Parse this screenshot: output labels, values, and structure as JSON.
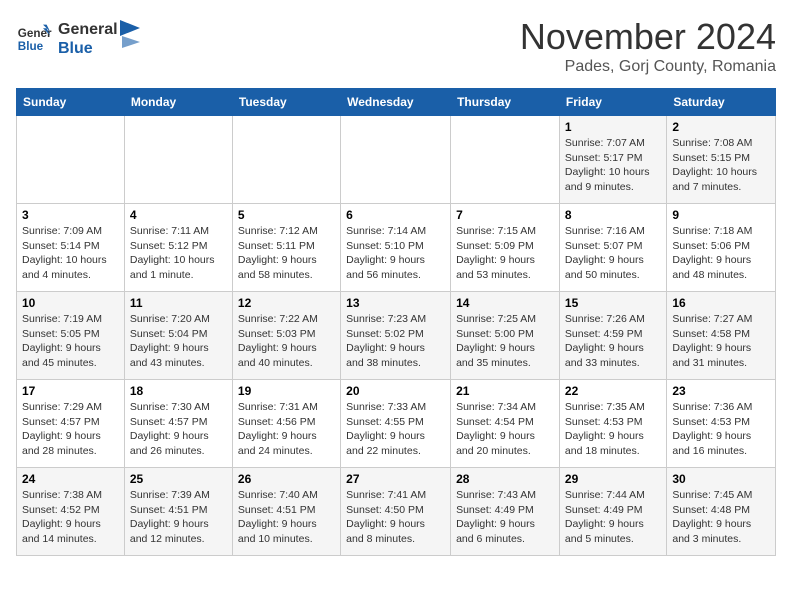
{
  "header": {
    "logo_line1": "General",
    "logo_line2": "Blue",
    "month_title": "November 2024",
    "location": "Pades, Gorj County, Romania"
  },
  "days_of_week": [
    "Sunday",
    "Monday",
    "Tuesday",
    "Wednesday",
    "Thursday",
    "Friday",
    "Saturday"
  ],
  "weeks": [
    [
      {
        "day": "",
        "info": ""
      },
      {
        "day": "",
        "info": ""
      },
      {
        "day": "",
        "info": ""
      },
      {
        "day": "",
        "info": ""
      },
      {
        "day": "",
        "info": ""
      },
      {
        "day": "1",
        "info": "Sunrise: 7:07 AM\nSunset: 5:17 PM\nDaylight: 10 hours\nand 9 minutes."
      },
      {
        "day": "2",
        "info": "Sunrise: 7:08 AM\nSunset: 5:15 PM\nDaylight: 10 hours\nand 7 minutes."
      }
    ],
    [
      {
        "day": "3",
        "info": "Sunrise: 7:09 AM\nSunset: 5:14 PM\nDaylight: 10 hours\nand 4 minutes."
      },
      {
        "day": "4",
        "info": "Sunrise: 7:11 AM\nSunset: 5:12 PM\nDaylight: 10 hours\nand 1 minute."
      },
      {
        "day": "5",
        "info": "Sunrise: 7:12 AM\nSunset: 5:11 PM\nDaylight: 9 hours\nand 58 minutes."
      },
      {
        "day": "6",
        "info": "Sunrise: 7:14 AM\nSunset: 5:10 PM\nDaylight: 9 hours\nand 56 minutes."
      },
      {
        "day": "7",
        "info": "Sunrise: 7:15 AM\nSunset: 5:09 PM\nDaylight: 9 hours\nand 53 minutes."
      },
      {
        "day": "8",
        "info": "Sunrise: 7:16 AM\nSunset: 5:07 PM\nDaylight: 9 hours\nand 50 minutes."
      },
      {
        "day": "9",
        "info": "Sunrise: 7:18 AM\nSunset: 5:06 PM\nDaylight: 9 hours\nand 48 minutes."
      }
    ],
    [
      {
        "day": "10",
        "info": "Sunrise: 7:19 AM\nSunset: 5:05 PM\nDaylight: 9 hours\nand 45 minutes."
      },
      {
        "day": "11",
        "info": "Sunrise: 7:20 AM\nSunset: 5:04 PM\nDaylight: 9 hours\nand 43 minutes."
      },
      {
        "day": "12",
        "info": "Sunrise: 7:22 AM\nSunset: 5:03 PM\nDaylight: 9 hours\nand 40 minutes."
      },
      {
        "day": "13",
        "info": "Sunrise: 7:23 AM\nSunset: 5:02 PM\nDaylight: 9 hours\nand 38 minutes."
      },
      {
        "day": "14",
        "info": "Sunrise: 7:25 AM\nSunset: 5:00 PM\nDaylight: 9 hours\nand 35 minutes."
      },
      {
        "day": "15",
        "info": "Sunrise: 7:26 AM\nSunset: 4:59 PM\nDaylight: 9 hours\nand 33 minutes."
      },
      {
        "day": "16",
        "info": "Sunrise: 7:27 AM\nSunset: 4:58 PM\nDaylight: 9 hours\nand 31 minutes."
      }
    ],
    [
      {
        "day": "17",
        "info": "Sunrise: 7:29 AM\nSunset: 4:57 PM\nDaylight: 9 hours\nand 28 minutes."
      },
      {
        "day": "18",
        "info": "Sunrise: 7:30 AM\nSunset: 4:57 PM\nDaylight: 9 hours\nand 26 minutes."
      },
      {
        "day": "19",
        "info": "Sunrise: 7:31 AM\nSunset: 4:56 PM\nDaylight: 9 hours\nand 24 minutes."
      },
      {
        "day": "20",
        "info": "Sunrise: 7:33 AM\nSunset: 4:55 PM\nDaylight: 9 hours\nand 22 minutes."
      },
      {
        "day": "21",
        "info": "Sunrise: 7:34 AM\nSunset: 4:54 PM\nDaylight: 9 hours\nand 20 minutes."
      },
      {
        "day": "22",
        "info": "Sunrise: 7:35 AM\nSunset: 4:53 PM\nDaylight: 9 hours\nand 18 minutes."
      },
      {
        "day": "23",
        "info": "Sunrise: 7:36 AM\nSunset: 4:53 PM\nDaylight: 9 hours\nand 16 minutes."
      }
    ],
    [
      {
        "day": "24",
        "info": "Sunrise: 7:38 AM\nSunset: 4:52 PM\nDaylight: 9 hours\nand 14 minutes."
      },
      {
        "day": "25",
        "info": "Sunrise: 7:39 AM\nSunset: 4:51 PM\nDaylight: 9 hours\nand 12 minutes."
      },
      {
        "day": "26",
        "info": "Sunrise: 7:40 AM\nSunset: 4:51 PM\nDaylight: 9 hours\nand 10 minutes."
      },
      {
        "day": "27",
        "info": "Sunrise: 7:41 AM\nSunset: 4:50 PM\nDaylight: 9 hours\nand 8 minutes."
      },
      {
        "day": "28",
        "info": "Sunrise: 7:43 AM\nSunset: 4:49 PM\nDaylight: 9 hours\nand 6 minutes."
      },
      {
        "day": "29",
        "info": "Sunrise: 7:44 AM\nSunset: 4:49 PM\nDaylight: 9 hours\nand 5 minutes."
      },
      {
        "day": "30",
        "info": "Sunrise: 7:45 AM\nSunset: 4:48 PM\nDaylight: 9 hours\nand 3 minutes."
      }
    ]
  ]
}
